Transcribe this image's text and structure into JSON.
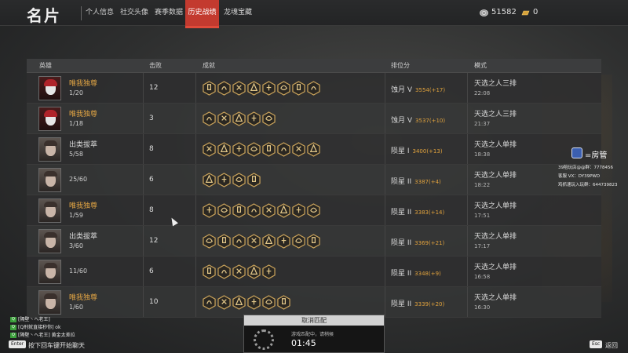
{
  "header": {
    "title": "名片",
    "tabs": [
      {
        "label": "个人信息",
        "active": false
      },
      {
        "label": "社交头像",
        "active": false
      },
      {
        "label": "赛季数据",
        "active": false
      },
      {
        "label": "历史战绩",
        "active": true
      },
      {
        "label": "龙魂宝藏",
        "active": false
      }
    ],
    "currency_silver": "51582",
    "currency_gold": "0"
  },
  "table": {
    "columns": [
      "英雄",
      "击败",
      "成就",
      "排位分",
      "模式"
    ],
    "rows": [
      {
        "hero": "唯我独尊",
        "gold": true,
        "avatar": "red",
        "record": "1/20",
        "kills": "12",
        "badges": 8,
        "rank": "蚀月 V",
        "score": "3554(+17)",
        "mode": "天选之人三排",
        "time": "22:08"
      },
      {
        "hero": "唯我独尊",
        "gold": true,
        "avatar": "red",
        "record": "1/18",
        "kills": "3",
        "badges": 5,
        "rank": "蚀月 V",
        "score": "3537(+10)",
        "mode": "天选之人三排",
        "time": "21:37"
      },
      {
        "hero": "出类拔萃",
        "gold": false,
        "avatar": "plain",
        "record": "5/58",
        "kills": "8",
        "badges": 8,
        "rank": "陨星 I",
        "score": "3400(+13)",
        "mode": "天选之人单排",
        "time": "18:38"
      },
      {
        "hero": "",
        "gold": false,
        "avatar": "plain",
        "record": "25/60",
        "kills": "6",
        "badges": 4,
        "rank": "陨星 II",
        "score": "3387(+4)",
        "mode": "天选之人单排",
        "time": "18:22"
      },
      {
        "hero": "唯我独尊",
        "gold": true,
        "avatar": "plain",
        "record": "1/59",
        "kills": "8",
        "badges": 8,
        "rank": "陨星 II",
        "score": "3383(+14)",
        "mode": "天选之人单排",
        "time": "17:51"
      },
      {
        "hero": "出类拔萃",
        "gold": false,
        "avatar": "plain",
        "record": "3/60",
        "kills": "12",
        "badges": 8,
        "rank": "陨星 II",
        "score": "3369(+21)",
        "mode": "天选之人单排",
        "time": "17:17"
      },
      {
        "hero": "",
        "gold": false,
        "avatar": "plain",
        "record": "11/60",
        "kills": "6",
        "badges": 5,
        "rank": "陨星 II",
        "score": "3348(+9)",
        "mode": "天选之人单排",
        "time": "16:58"
      },
      {
        "hero": "唯我独尊",
        "gold": true,
        "avatar": "plain",
        "record": "1/60",
        "kills": "10",
        "badges": 6,
        "rank": "陨星 II",
        "score": "3339(+20)",
        "mode": "天选之人单排",
        "time": "16:30"
      }
    ]
  },
  "overlay": {
    "fangguan": "=房管",
    "line1": "39陪玩店@@群：7778456",
    "line2": "客服 VX：DY39PWD",
    "line3": "鸡抓速玩入玩群：644739823"
  },
  "chat": {
    "lines": [
      "[隔壁丶へ老王]",
      "[Q刑就直接秒你] ok",
      "[隔壁丶へ老王] 黄金太差拉"
    ],
    "enter_key": "Enter",
    "enter_hint": "按下回车键开始聊天"
  },
  "match": {
    "cancel_label": "取消匹配",
    "status": "游戏匹配中，请稍候",
    "timer": "01:45"
  },
  "footer": {
    "esc_key": "Esc",
    "back_label": "返回"
  }
}
